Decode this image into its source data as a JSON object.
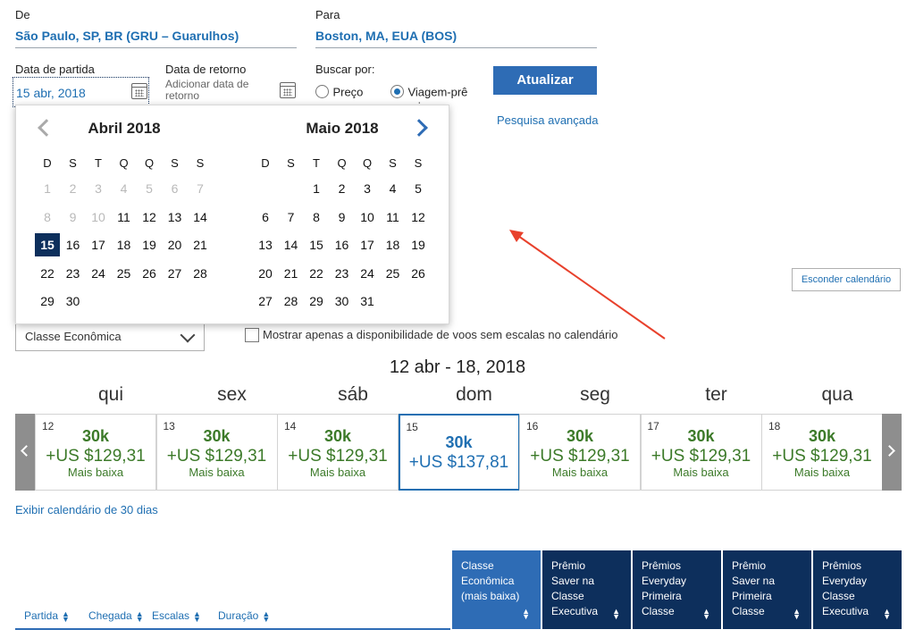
{
  "search": {
    "from_label": "De",
    "from_value": "São Paulo, SP, BR (GRU – Guarulhos)",
    "to_label": "Para",
    "to_value": "Boston, MA, EUA (BOS)",
    "depart_label": "Data de partida",
    "depart_value": "15 abr, 2018",
    "return_label": "Data de retorno",
    "return_placeholder_1": "Adicionar data de",
    "return_placeholder_2": "retorno",
    "search_by_label": "Buscar por:",
    "option_price": "Preço",
    "option_award_1": "Viagem-prê",
    "option_award_2": "mio",
    "update_button": "Atualizar",
    "advanced_link": "Pesquisa avançada"
  },
  "calendar": {
    "left_month": "Abril 2018",
    "right_month": "Maio 2018",
    "weekdays": [
      "D",
      "S",
      "T",
      "Q",
      "Q",
      "S",
      "S"
    ],
    "april_rows": [
      [
        "1",
        "2",
        "3",
        "4",
        "5",
        "6",
        "7"
      ],
      [
        "8",
        "9",
        "10",
        "11",
        "12",
        "13",
        "14"
      ],
      [
        "15",
        "16",
        "17",
        "18",
        "19",
        "20",
        "21"
      ],
      [
        "22",
        "23",
        "24",
        "25",
        "26",
        "27",
        "28"
      ],
      [
        "29",
        "30",
        "",
        "",
        "",
        "",
        ""
      ]
    ],
    "april_disabled_through": 10,
    "april_selected": "15",
    "may_rows": [
      [
        "",
        "",
        "1",
        "2",
        "3",
        "4",
        "5"
      ],
      [
        "6",
        "7",
        "8",
        "9",
        "10",
        "11",
        "12"
      ],
      [
        "13",
        "14",
        "15",
        "16",
        "17",
        "18",
        "19"
      ],
      [
        "20",
        "21",
        "22",
        "23",
        "24",
        "25",
        "26"
      ],
      [
        "27",
        "28",
        "29",
        "30",
        "31",
        "",
        ""
      ]
    ]
  },
  "hide_calendar_button": "Esconder calendário",
  "cabin_select": "Classe Econômica",
  "nonstop_checkbox_label": "Mostrar apenas a disponibilidade de voos sem escalas no calendário",
  "week": {
    "title": "12 abr - 18, 2018",
    "days": [
      {
        "dow": "qui",
        "num": "12",
        "points": "30k",
        "price": "+US $129,31",
        "note": "Mais baixa",
        "selected": false
      },
      {
        "dow": "sex",
        "num": "13",
        "points": "30k",
        "price": "+US $129,31",
        "note": "Mais baixa",
        "selected": false
      },
      {
        "dow": "sáb",
        "num": "14",
        "points": "30k",
        "price": "+US $129,31",
        "note": "Mais baixa",
        "selected": false
      },
      {
        "dow": "dom",
        "num": "15",
        "points": "30k",
        "price": "+US $137,81",
        "note": "",
        "selected": true
      },
      {
        "dow": "seg",
        "num": "16",
        "points": "30k",
        "price": "+US $129,31",
        "note": "Mais baixa",
        "selected": false
      },
      {
        "dow": "ter",
        "num": "17",
        "points": "30k",
        "price": "+US $129,31",
        "note": "Mais baixa",
        "selected": false
      },
      {
        "dow": "qua",
        "num": "18",
        "points": "30k",
        "price": "+US $129,31",
        "note": "Mais baixa",
        "selected": false
      }
    ]
  },
  "thirty_day_link": "Exibir calendário de 30 dias",
  "table": {
    "columns": [
      "Partida",
      "Chegada",
      "Escalas",
      "Duração"
    ],
    "fare_headers": [
      {
        "lines": [
          "Classe",
          "Econômica",
          "(mais baixa)"
        ],
        "active": true
      },
      {
        "lines": [
          "Prêmio",
          "Saver na",
          "Classe",
          "Executiva"
        ],
        "active": false
      },
      {
        "lines": [
          "Prêmios",
          "Everyday",
          "Primeira",
          "Classe"
        ],
        "active": false
      },
      {
        "lines": [
          "Prêmio",
          "Saver na",
          "Primeira",
          "Classe"
        ],
        "active": false
      },
      {
        "lines": [
          "Prêmios",
          "Everyday",
          "Classe",
          "Executiva"
        ],
        "active": false
      }
    ]
  },
  "colors": {
    "link_blue": "#1f6fb2",
    "primary_button": "#2e6cb5",
    "navy": "#0d2f5c",
    "price_green": "#3c7a29",
    "annotation_arrow": "#e8412c"
  }
}
